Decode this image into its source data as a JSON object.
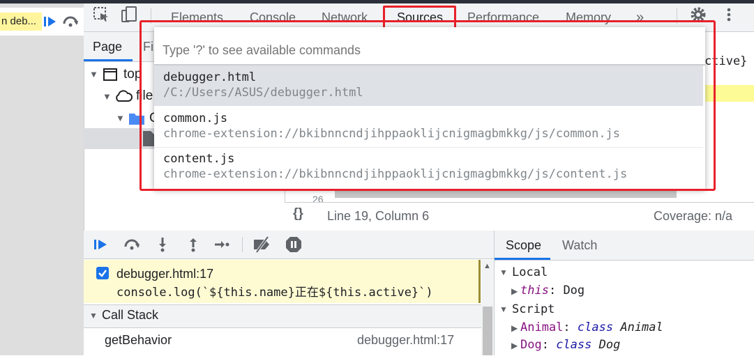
{
  "page": {
    "paused_label": "n deb..."
  },
  "toolbar": {
    "tabs": [
      "Elements",
      "Console",
      "Network",
      "Sources",
      "Performance",
      "Memory"
    ],
    "more": "»"
  },
  "navigator": {
    "tab_page": "Page",
    "tab_files": "Fil",
    "tree": [
      "top",
      "file",
      "C"
    ]
  },
  "editor": {
    "code_fragment": "ctive}",
    "line_number": "26",
    "format": "{}",
    "cursor_position": "Line 19, Column 6",
    "coverage": "Coverage: n/a"
  },
  "command_menu": {
    "placeholder": "Type '?' to see available commands",
    "items": [
      {
        "title": "debugger.html",
        "subtitle": "/C:/Users/ASUS/debugger.html"
      },
      {
        "title": "common.js",
        "subtitle": "chrome-extension://bkibnncndjihppaoklijcnigmagbmkkg/js/common.js"
      },
      {
        "title": "content.js",
        "subtitle": "chrome-extension://bkibnncndjihppaoklijcnigmagbmkkg/js/content.js"
      }
    ]
  },
  "breakpoint": {
    "file": "debugger.html:17",
    "code": "console.log(`${this.name}正在${this.active}`)"
  },
  "call_stack": {
    "title": "Call Stack",
    "frames": [
      {
        "name": "getBehavior",
        "location": "debugger.html:17"
      }
    ]
  },
  "scope": {
    "tab_scope": "Scope",
    "tab_watch": "Watch",
    "local_label": "Local",
    "this_key": "this",
    "this_value": "Dog",
    "script_label": "Script",
    "animal_key": "Animal",
    "animal_value": "Animal",
    "dog_key": "Dog",
    "dog_value": "Dog",
    "class_kw": "class"
  },
  "colors": {
    "accent": "#1a73e8",
    "highlight_red": "#e8202a",
    "paused_yellow": "#fff59d"
  }
}
